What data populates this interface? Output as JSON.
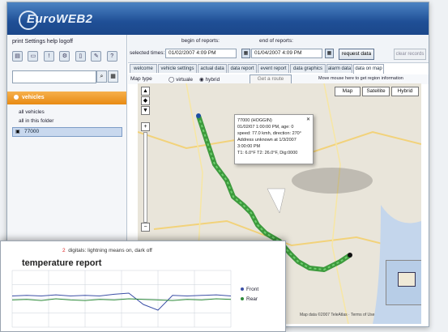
{
  "app": {
    "title": "EuroWEB2"
  },
  "left": {
    "menu": "print Settings help logoff",
    "search": {
      "value": "",
      "placeholder": ""
    },
    "vehicles_header": "vehicles",
    "items": [
      "all vehicles",
      "all in this folder",
      "77000"
    ]
  },
  "params": {
    "selected_times_label": "selected times:",
    "begin_label": "begin of reports:",
    "begin_value": "01/02/2007 4:09 PM",
    "end_label": "end of reports:",
    "end_value": "01/04/2007 4:09 PM",
    "request_button": "request data",
    "clear_button": "clear records"
  },
  "tabs": [
    "welcome",
    "vehicle settings",
    "actual data",
    "data report",
    "event report",
    "data graphics",
    "alarm data",
    "data on map"
  ],
  "active_tab": 7,
  "map": {
    "maptype_label": "Map type",
    "maptype_options": [
      "virtuale",
      "hybrid"
    ],
    "center_button": "Get a route",
    "hint": "Move mouse here to get region information",
    "type_buttons": [
      "Map",
      "Satellite",
      "Hybrid"
    ],
    "info_lines": [
      "77000 (HOGGIN)",
      "01/02/07 1:00:00 PM, age: 0",
      "speed: 77.0 kmh, direction: 270°",
      "Address unknown at 1/3/2007 3:00:00 PM",
      "T1: 6.0°F T2: 26.0°F, Dig:0000"
    ],
    "footer": "Map data ©2007 TeleAtlas · Terms of Use"
  },
  "temperature_report": {
    "legend_caption": "digitals: lightning means on, dark off",
    "legend_marker": "2",
    "title": "temperature report",
    "legend": [
      {
        "name": "Front",
        "color": "#3b4fa6"
      },
      {
        "name": "Rear",
        "color": "#2e8b3a"
      }
    ]
  },
  "chart_data": {
    "type": "line",
    "title": "temperature report",
    "series": [
      {
        "name": "Front",
        "values": [
          55,
          56,
          55,
          57,
          55,
          56,
          55,
          58,
          60,
          40,
          30,
          56,
          55,
          56,
          57,
          55
        ]
      },
      {
        "name": "Rear",
        "values": [
          48,
          49,
          47,
          50,
          48,
          47,
          49,
          48,
          50,
          49,
          48,
          47,
          49,
          48,
          50,
          49
        ]
      }
    ]
  }
}
